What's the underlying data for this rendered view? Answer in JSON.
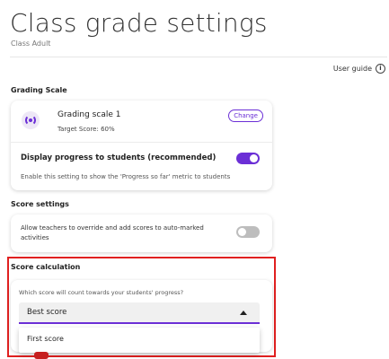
{
  "page": {
    "title": "Class grade settings",
    "subtitle": "Class Adult",
    "user_guide_label": "User guide",
    "info_icon_glyph": "i"
  },
  "grading_scale": {
    "section_title": "Grading Scale",
    "scale_name": "Grading scale 1",
    "target_score": "Target Score: 60%",
    "change_label": "Change",
    "display_progress_label": "Display progress to students (recommended)",
    "display_progress_desc": "Enable this setting to show the 'Progress so far' metric to students",
    "display_progress_on": true
  },
  "score_settings": {
    "section_title": "Score settings",
    "override_label": "Allow teachers to override and add scores to auto-marked activities",
    "override_on": false
  },
  "score_calculation": {
    "section_title": "Score calculation",
    "question": "Which score will count towards your students' progress?",
    "selected_value": "Best score",
    "options": [
      "First score"
    ]
  },
  "colors": {
    "accent": "#6b2fd6",
    "highlight_border": "#e02020"
  },
  "icons": {
    "info": "info-icon",
    "scale": "grading-scale-icon",
    "caret": "caret-up-icon"
  }
}
